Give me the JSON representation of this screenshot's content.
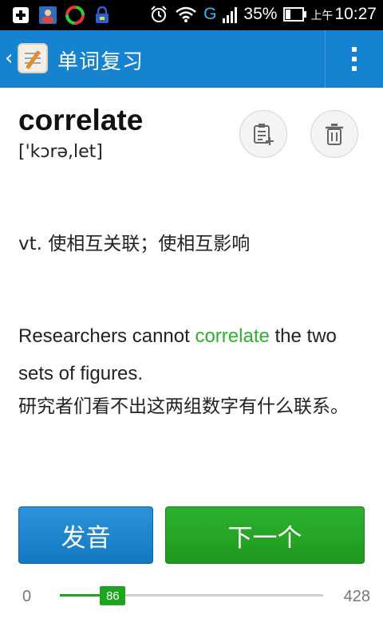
{
  "status_bar": {
    "signal_letter": "G",
    "battery_percent": "35%",
    "time_prefix": "上午",
    "time": "10:27",
    "icons": [
      "add-icon",
      "contacts-app-icon",
      "photo-app-icon",
      "lock-bag-icon",
      "alarm-icon",
      "wifi-icon",
      "signal-icon",
      "battery-icon"
    ],
    "battery_level": 0.35
  },
  "action_bar": {
    "title": "单词复习",
    "back_icon": "chevron-left-icon",
    "logo_icon": "app-logo-icon",
    "menu_icon": "overflow-menu-icon",
    "background_color": "#1583cf"
  },
  "word": {
    "text": "correlate",
    "phonetic": "['kɔrə,let]"
  },
  "actions": {
    "add_icon": "add-to-notebook-icon",
    "delete_icon": "trash-icon"
  },
  "definition": "vt. 使相互关联；使相互影响",
  "example": {
    "before": "Researchers cannot ",
    "highlight": "correlate",
    "after": " the two sets of figures.",
    "highlight_color": "#2db22d",
    "translation": "研究者们看不出这两组数字有什么联系。"
  },
  "buttons": {
    "pronounce": "发音",
    "next": "下一个"
  },
  "progress": {
    "min": "0",
    "max": "428",
    "current": "86",
    "current_value": 86,
    "max_value": 428,
    "color": "#1ea51e"
  }
}
